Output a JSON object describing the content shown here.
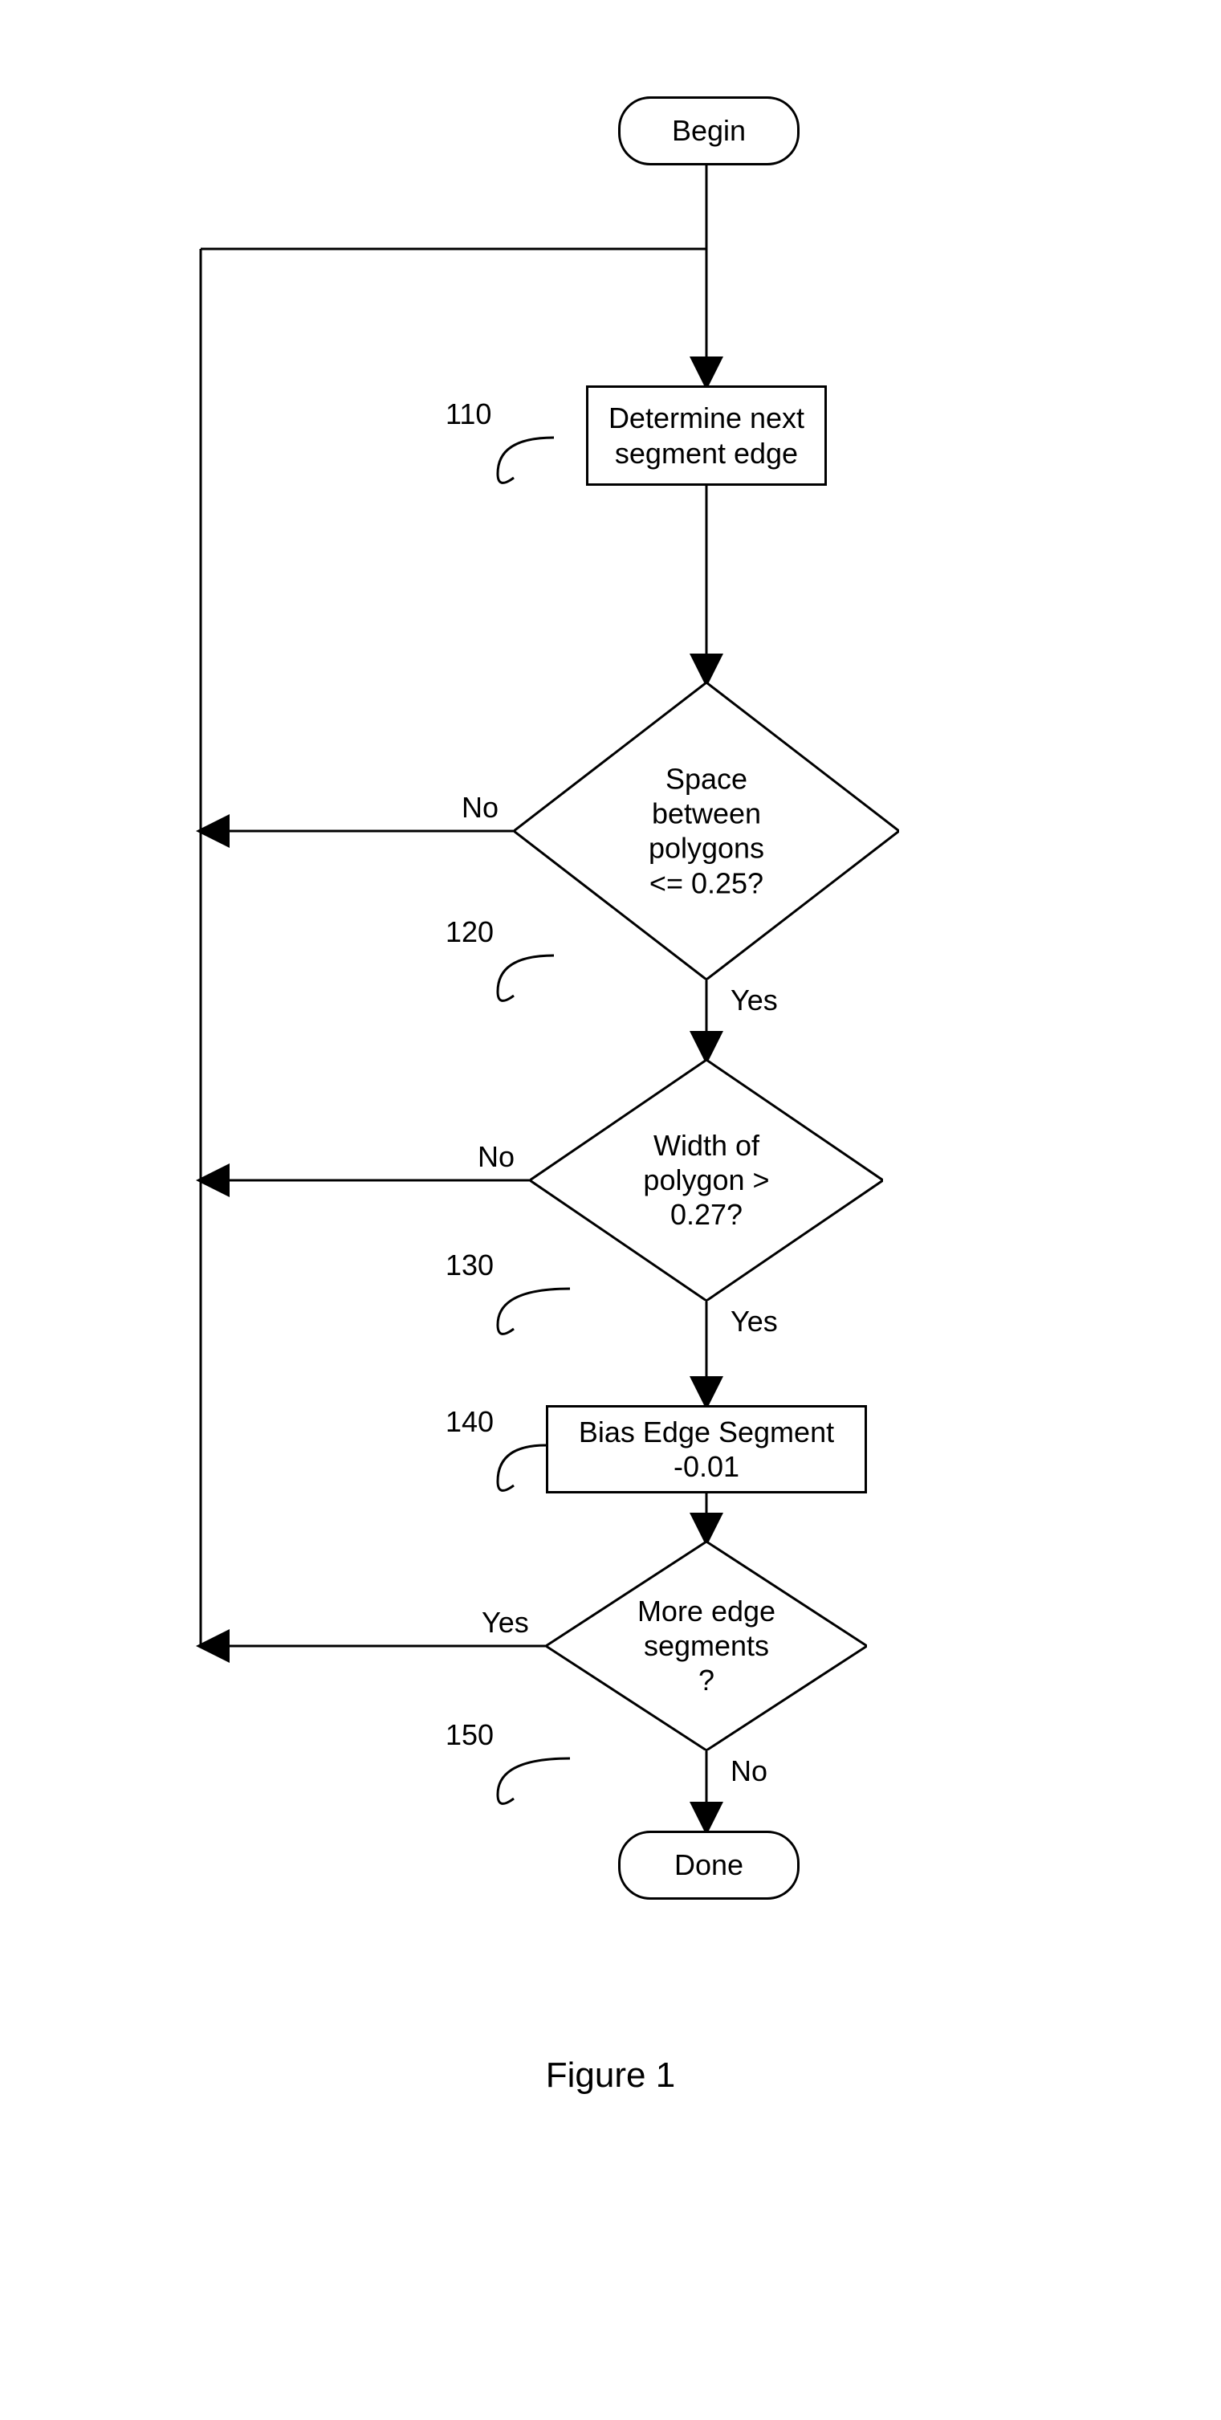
{
  "chart_data": {
    "type": "flowchart",
    "title": "Figure 1",
    "nodes": [
      {
        "id": "begin",
        "type": "terminator",
        "text": "Begin"
      },
      {
        "id": "110",
        "type": "process",
        "text": "Determine next segment edge",
        "ref": "110"
      },
      {
        "id": "120",
        "type": "decision",
        "text": "Space between polygons <= 0.25?",
        "ref": "120"
      },
      {
        "id": "130",
        "type": "decision",
        "text": "Width of polygon > 0.27?",
        "ref": "130"
      },
      {
        "id": "140",
        "type": "process",
        "text": "Bias Edge Segment -0.01",
        "ref": "140"
      },
      {
        "id": "150",
        "type": "decision",
        "text": "More edge segments ?",
        "ref": "150"
      },
      {
        "id": "done",
        "type": "terminator",
        "text": "Done"
      }
    ],
    "edges": [
      {
        "from": "begin",
        "to": "110"
      },
      {
        "from": "110",
        "to": "120"
      },
      {
        "from": "120",
        "to": "130",
        "label": "Yes"
      },
      {
        "from": "120",
        "to": "loop",
        "label": "No"
      },
      {
        "from": "130",
        "to": "140",
        "label": "Yes"
      },
      {
        "from": "130",
        "to": "loop",
        "label": "No"
      },
      {
        "from": "140",
        "to": "150"
      },
      {
        "from": "150",
        "to": "loop",
        "label": "Yes"
      },
      {
        "from": "150",
        "to": "done",
        "label": "No"
      }
    ]
  },
  "nodes": {
    "begin": "Begin",
    "done": "Done",
    "n110": "Determine next\nsegment edge",
    "n120": "Space\nbetween\npolygons\n<= 0.25?",
    "n130": "Width of\npolygon >\n0.27?",
    "n140": "Bias Edge Segment\n-0.01",
    "n150": "More edge\nsegments\n?"
  },
  "refs": {
    "r110": "110",
    "r120": "120",
    "r130": "130",
    "r140": "140",
    "r150": "150"
  },
  "labels": {
    "yes": "Yes",
    "no": "No"
  },
  "caption": "Figure 1"
}
